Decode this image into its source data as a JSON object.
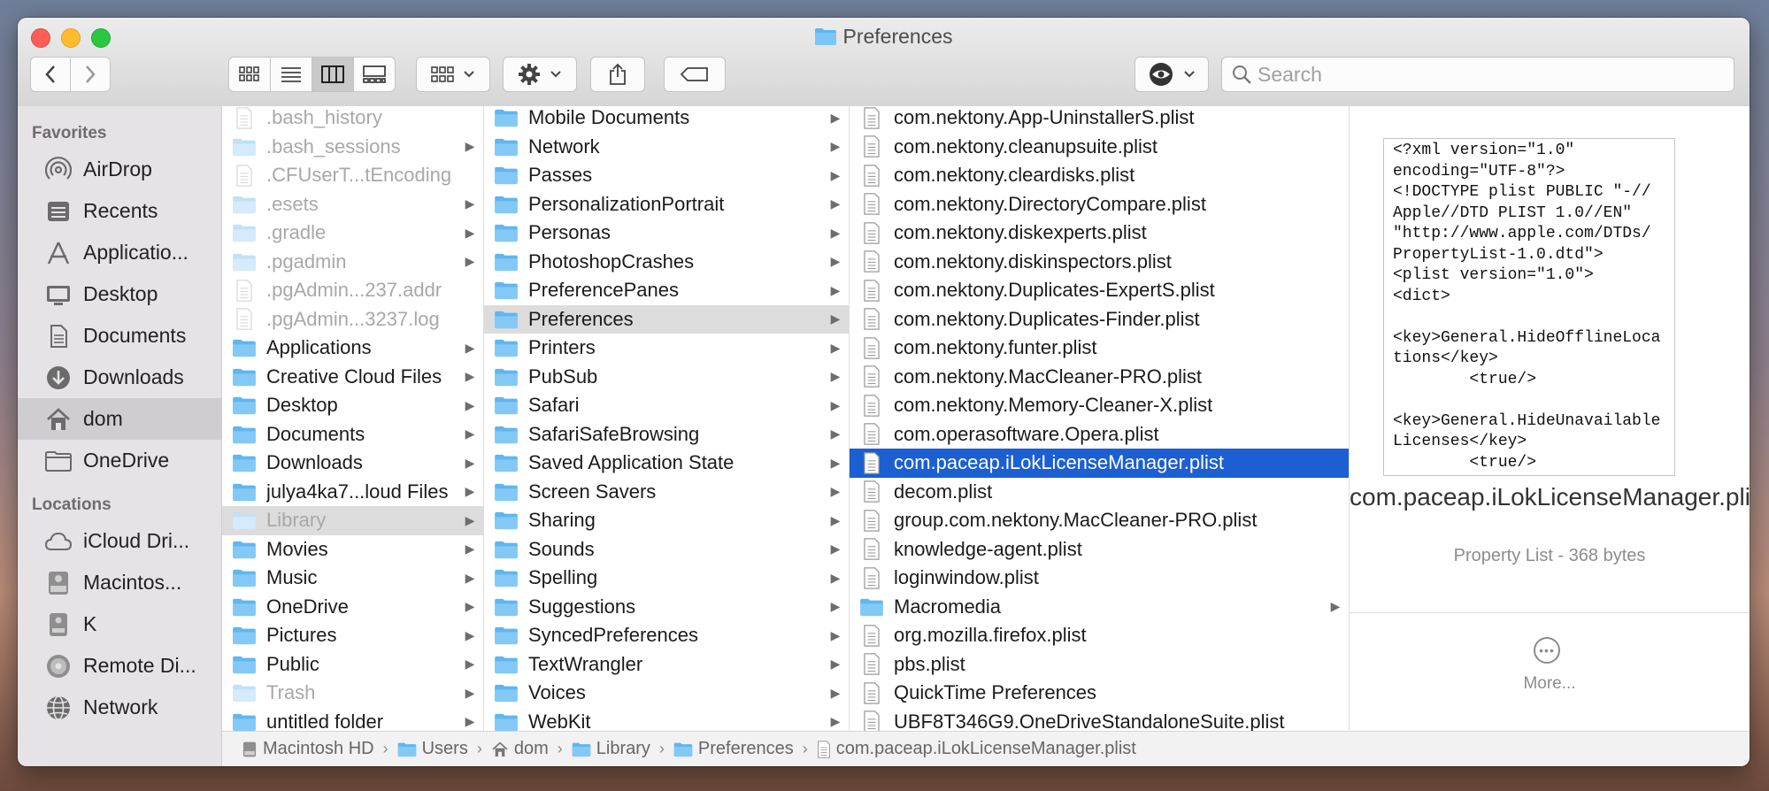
{
  "window": {
    "title": "Preferences",
    "search_placeholder": "Search"
  },
  "sidebar": {
    "favorites_heading": "Favorites",
    "favorites": [
      {
        "label": "AirDrop",
        "icon": "airdrop-icon"
      },
      {
        "label": "Recents",
        "icon": "recents-icon"
      },
      {
        "label": "Applicatio...",
        "icon": "applications-icon"
      },
      {
        "label": "Desktop",
        "icon": "desktop-icon"
      },
      {
        "label": "Documents",
        "icon": "documents-icon"
      },
      {
        "label": "Downloads",
        "icon": "downloads-icon"
      },
      {
        "label": "dom",
        "icon": "home-icon",
        "selected": true
      },
      {
        "label": "OneDrive",
        "icon": "folder-icon"
      }
    ],
    "locations_heading": "Locations",
    "locations": [
      {
        "label": "iCloud Dri...",
        "icon": "icloud-icon"
      },
      {
        "label": "Macintos...",
        "icon": "harddisk-icon"
      },
      {
        "label": "K",
        "icon": "external-disk-icon"
      },
      {
        "label": "Remote Di...",
        "icon": "remote-disc-icon"
      },
      {
        "label": "Network",
        "icon": "network-icon"
      }
    ]
  },
  "column1": [
    {
      "name": ".bash_history",
      "kind": "file",
      "dim": true
    },
    {
      "name": ".bash_sessions",
      "kind": "folder",
      "dim": true
    },
    {
      "name": ".CFUserT...tEncoding",
      "kind": "file",
      "dim": true
    },
    {
      "name": ".esets",
      "kind": "folder",
      "dim": true
    },
    {
      "name": ".gradle",
      "kind": "folder",
      "dim": true
    },
    {
      "name": ".pgadmin",
      "kind": "folder",
      "dim": true
    },
    {
      "name": ".pgAdmin...237.addr",
      "kind": "file",
      "dim": true
    },
    {
      "name": ".pgAdmin...3237.log",
      "kind": "file",
      "dim": true
    },
    {
      "name": "Applications",
      "kind": "folder"
    },
    {
      "name": "Creative Cloud Files",
      "kind": "folder"
    },
    {
      "name": "Desktop",
      "kind": "folder"
    },
    {
      "name": "Documents",
      "kind": "folder"
    },
    {
      "name": "Downloads",
      "kind": "folder"
    },
    {
      "name": "julya4ka7...loud Files",
      "kind": "folder"
    },
    {
      "name": "Library",
      "kind": "folder",
      "dim": true,
      "selected": "gray"
    },
    {
      "name": "Movies",
      "kind": "folder"
    },
    {
      "name": "Music",
      "kind": "folder"
    },
    {
      "name": "OneDrive",
      "kind": "folder"
    },
    {
      "name": "Pictures",
      "kind": "folder"
    },
    {
      "name": "Public",
      "kind": "folder"
    },
    {
      "name": "Trash",
      "kind": "folder",
      "dim": true
    },
    {
      "name": "untitled folder",
      "kind": "folder"
    }
  ],
  "column2": [
    {
      "name": "Mobile Documents",
      "kind": "folder"
    },
    {
      "name": "Network",
      "kind": "folder"
    },
    {
      "name": "Passes",
      "kind": "folder"
    },
    {
      "name": "PersonalizationPortrait",
      "kind": "folder"
    },
    {
      "name": "Personas",
      "kind": "folder"
    },
    {
      "name": "PhotoshopCrashes",
      "kind": "folder"
    },
    {
      "name": "PreferencePanes",
      "kind": "folder"
    },
    {
      "name": "Preferences",
      "kind": "folder",
      "selected": "gray"
    },
    {
      "name": "Printers",
      "kind": "folder"
    },
    {
      "name": "PubSub",
      "kind": "folder"
    },
    {
      "name": "Safari",
      "kind": "folder"
    },
    {
      "name": "SafariSafeBrowsing",
      "kind": "folder"
    },
    {
      "name": "Saved Application State",
      "kind": "folder"
    },
    {
      "name": "Screen Savers",
      "kind": "folder"
    },
    {
      "name": "Sharing",
      "kind": "folder"
    },
    {
      "name": "Sounds",
      "kind": "folder"
    },
    {
      "name": "Spelling",
      "kind": "folder"
    },
    {
      "name": "Suggestions",
      "kind": "folder"
    },
    {
      "name": "SyncedPreferences",
      "kind": "folder"
    },
    {
      "name": "TextWrangler",
      "kind": "folder"
    },
    {
      "name": "Voices",
      "kind": "folder"
    },
    {
      "name": "WebKit",
      "kind": "folder"
    }
  ],
  "column3": [
    {
      "name": "com.nektony.App-UninstallerS.plist",
      "kind": "file"
    },
    {
      "name": "com.nektony.cleanupsuite.plist",
      "kind": "file"
    },
    {
      "name": "com.nektony.cleardisks.plist",
      "kind": "file"
    },
    {
      "name": "com.nektony.DirectoryCompare.plist",
      "kind": "file"
    },
    {
      "name": "com.nektony.diskexperts.plist",
      "kind": "file"
    },
    {
      "name": "com.nektony.diskinspectors.plist",
      "kind": "file"
    },
    {
      "name": "com.nektony.Duplicates-ExpertS.plist",
      "kind": "file"
    },
    {
      "name": "com.nektony.Duplicates-Finder.plist",
      "kind": "file"
    },
    {
      "name": "com.nektony.funter.plist",
      "kind": "file"
    },
    {
      "name": "com.nektony.MacCleaner-PRO.plist",
      "kind": "file"
    },
    {
      "name": "com.nektony.Memory-Cleaner-X.plist",
      "kind": "file"
    },
    {
      "name": "com.operasoftware.Opera.plist",
      "kind": "file"
    },
    {
      "name": "com.paceap.iLokLicenseManager.plist",
      "kind": "file",
      "selected": "blue"
    },
    {
      "name": "decom.plist",
      "kind": "file"
    },
    {
      "name": "group.com.nektony.MacCleaner-PRO.plist",
      "kind": "file"
    },
    {
      "name": "knowledge-agent.plist",
      "kind": "file"
    },
    {
      "name": "loginwindow.plist",
      "kind": "file"
    },
    {
      "name": "Macromedia",
      "kind": "folder"
    },
    {
      "name": "org.mozilla.firefox.plist",
      "kind": "file"
    },
    {
      "name": "pbs.plist",
      "kind": "file"
    },
    {
      "name": "QuickTime Preferences",
      "kind": "file"
    },
    {
      "name": "UBF8T346G9.OneDriveStandaloneSuite.plist",
      "kind": "file"
    }
  ],
  "preview": {
    "content": "<?xml version=\"1.0\"\nencoding=\"UTF-8\"?>\n<!DOCTYPE plist PUBLIC \"-//\nApple//DTD PLIST 1.0//EN\"\n\"http://www.apple.com/DTDs/\nPropertyList-1.0.dtd\">\n<plist version=\"1.0\">\n<dict>\n\n<key>General.HideOfflineLoca\ntions</key>\n        <true/>\n\n<key>General.HideUnavailable\nLicenses</key>\n        <true/>",
    "name": "com.paceap.iLokLicenseManager.plist",
    "meta": "Property List - 368 bytes",
    "more_label": "More..."
  },
  "pathbar": [
    {
      "label": "Macintosh HD",
      "icon": "harddisk-icon"
    },
    {
      "label": "Users",
      "icon": "folder-icon"
    },
    {
      "label": "dom",
      "icon": "home-icon"
    },
    {
      "label": "Library",
      "icon": "folder-icon"
    },
    {
      "label": "Preferences",
      "icon": "folder-icon"
    },
    {
      "label": "com.paceap.iLokLicenseManager.plist",
      "icon": "file-icon"
    }
  ],
  "colors": {
    "selection_blue": "#1b5fd3",
    "folder_blue": "#5fb6f0",
    "sidebar_bg": "#e6e3e6"
  }
}
